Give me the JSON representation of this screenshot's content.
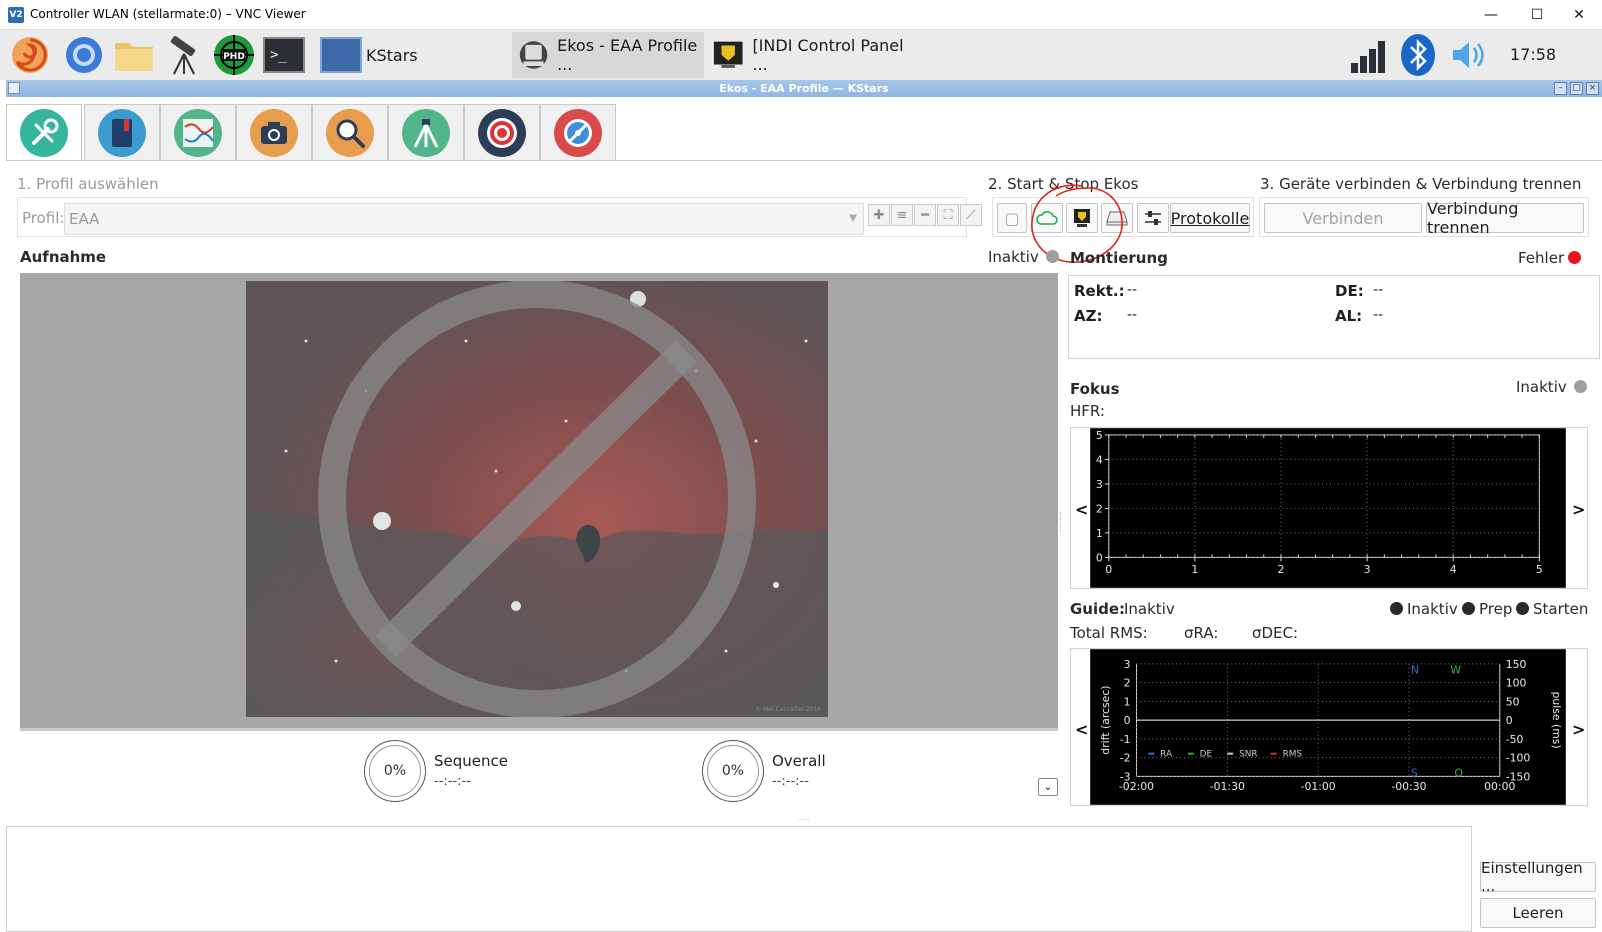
{
  "window": {
    "title": "Controller WLAN (stellarmate:0) – VNC Viewer",
    "logo_text": "V2",
    "min_glyph": "—",
    "max_glyph": "☐",
    "close_glyph": "✕"
  },
  "taskbar": {
    "tasks": [
      {
        "label": "KStars"
      },
      {
        "label": "Ekos - EAA Profile ..."
      },
      {
        "label": "[INDI Control Panel ..."
      }
    ],
    "phd_text": "PHD",
    "terminal_text": ">_",
    "clock": "17:58"
  },
  "ekos": {
    "title": "Ekos - EAA Profile — KStars",
    "profile": {
      "section_label": "1. Profil auswählen",
      "field_label": "Profil:",
      "value": "EAA"
    },
    "start_stop": {
      "section_label": "2. Start & Stop Ekos",
      "logs_button": "Protokolle"
    },
    "devices": {
      "section_label": "3. Geräte verbinden & Verbindung trennen",
      "connect_button": "Verbinden",
      "disconnect_button": "Verbindung trennen"
    },
    "capture": {
      "title": "Aufnahme",
      "status": "Inaktiv",
      "image_watermark": "© Mel Canceller 2016",
      "sequence_label": "Sequence",
      "sequence_pct": "0%",
      "sequence_time": "--:--:--",
      "overall_label": "Overall",
      "overall_pct": "0%",
      "overall_time": "--:--:--"
    },
    "mount": {
      "title": "Montierung",
      "status": "Fehler",
      "status_color": "#e8141c",
      "ra_label": "Rekt.:",
      "ra_value": "--",
      "de_label": "DE:",
      "de_value": "--",
      "az_label": "AZ:",
      "az_value": "--",
      "al_label": "AL:",
      "al_value": "--"
    },
    "focus": {
      "title": "Fokus",
      "status": "Inaktiv",
      "hfr_label": "HFR:",
      "prev_arrow": "<",
      "next_arrow": ">"
    },
    "guide": {
      "title": "Guide:",
      "status": "Inaktiv",
      "options": [
        "Inaktiv",
        "Prep",
        "Starten"
      ],
      "total_rms_label": "Total RMS:",
      "sigma_ra_label": "σRA:",
      "sigma_dec_label": "σDEC:",
      "prev_arrow": "<",
      "next_arrow": ">"
    },
    "log_panel": {
      "settings_button": "Einstellungen ...",
      "clear_button": "Leeren"
    }
  },
  "chart_data": [
    {
      "type": "line",
      "name": "Fokus HFR",
      "x_ticks": [
        "0",
        "1",
        "2",
        "3",
        "4",
        "5"
      ],
      "y_ticks": [
        "0",
        "1",
        "2",
        "3",
        "4",
        "5"
      ],
      "xlim": [
        0,
        5
      ],
      "ylim": [
        0,
        5
      ],
      "grid": true,
      "series": []
    },
    {
      "type": "line",
      "name": "Guide drift",
      "ylabel": "drift (arcsec)",
      "y2label": "pulse (ms)",
      "x_ticks": [
        "-02:00",
        "-01:30",
        "-01:00",
        "-00:30",
        "00:00"
      ],
      "y_ticks": [
        "-3",
        "-2",
        "-1",
        "0",
        "1",
        "2",
        "3"
      ],
      "y2_ticks": [
        "-150",
        "-100",
        "-50",
        "0",
        "50",
        "100",
        "150"
      ],
      "ylim": [
        -3,
        3
      ],
      "y2lim": [
        -150,
        150
      ],
      "grid": true,
      "legend": [
        "RA",
        "DE",
        "SNR",
        "RMS"
      ],
      "legend_colors": [
        "#2f6fd6",
        "#33b533",
        "#cccccc",
        "#d83030"
      ],
      "legend_position": "bottom-left",
      "compass": {
        "N": "N",
        "W": "W",
        "S": "S",
        "O": "O"
      },
      "series": []
    }
  ]
}
